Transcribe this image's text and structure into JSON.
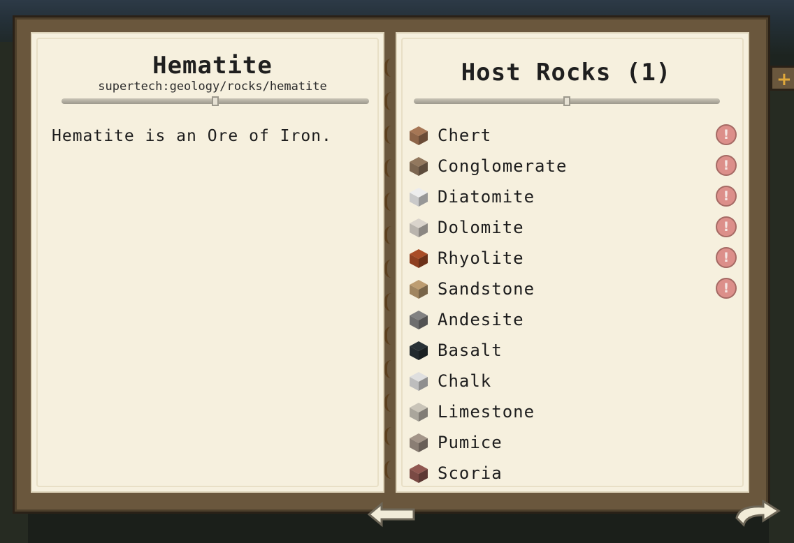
{
  "left_page": {
    "title": "Hematite",
    "subtitle": "supertech:geology/rocks/hematite",
    "description": "Hematite is an Ore of Iron."
  },
  "right_page": {
    "title": "Host Rocks (1)",
    "rocks": [
      {
        "label": "Chert",
        "color": "#8d6448",
        "warning": true
      },
      {
        "label": "Conglomerate",
        "color": "#7c6650",
        "warning": true
      },
      {
        "label": "Diatomite",
        "color": "#c9c9c9",
        "warning": true
      },
      {
        "label": "Dolomite",
        "color": "#b9b4ad",
        "warning": true
      },
      {
        "label": "Rhyolite",
        "color": "#8f4020",
        "warning": true
      },
      {
        "label": "Sandstone",
        "color": "#a08560",
        "warning": true
      },
      {
        "label": "Andesite",
        "color": "#6e6e6e",
        "warning": false
      },
      {
        "label": "Basalt",
        "color": "#232a2e",
        "warning": false
      },
      {
        "label": "Chalk",
        "color": "#bdbdbd",
        "warning": false
      },
      {
        "label": "Limestone",
        "color": "#aaa69c",
        "warning": false
      },
      {
        "label": "Pumice",
        "color": "#8a7e74",
        "warning": false
      },
      {
        "label": "Scoria",
        "color": "#7a4a44",
        "warning": false
      }
    ]
  },
  "warning_icon": "exclamation-icon",
  "navigation": {
    "back_icon": "back-arrow-icon",
    "next_icon": "next-arrow-icon"
  },
  "side_tab_icon": "plus-icon",
  "colors": {
    "page": "#f6f0de",
    "cover": "#6a573d",
    "text": "#1d1d1d"
  }
}
